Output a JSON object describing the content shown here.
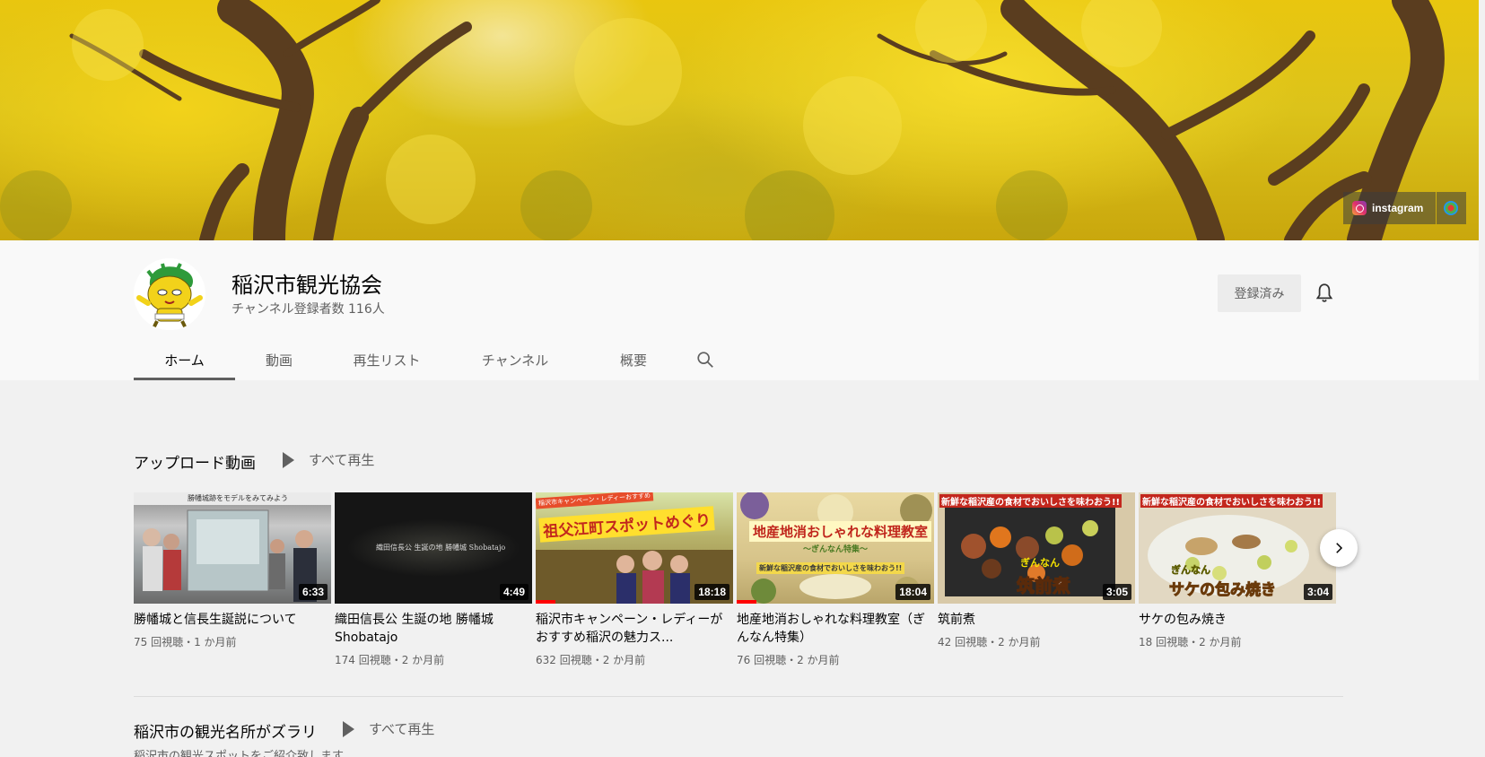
{
  "banner": {
    "links": [
      {
        "label": "instagram",
        "icon": "instagram-icon"
      },
      {
        "label": "",
        "icon": "external-link-icon"
      }
    ]
  },
  "channel": {
    "name": "稲沢市観光協会",
    "subscribers": "チャンネル登録者数 116人",
    "subscribed_label": "登録済み",
    "bell_icon": "bell-icon"
  },
  "tabs": [
    {
      "label": "ホーム",
      "active": true
    },
    {
      "label": "動画",
      "active": false
    },
    {
      "label": "再生リスト",
      "active": false
    },
    {
      "label": "チャンネル",
      "active": false
    },
    {
      "label": "概要",
      "active": false
    }
  ],
  "uploads": {
    "title": "アップロード動画",
    "play_all": "すべて再生",
    "videos": [
      {
        "title": "勝幡城と信長生誕説について",
        "meta": "75 回視聴・1 か月前",
        "duration": "6:33",
        "watched": 0
      },
      {
        "title": "織田信長公 生誕の地 勝幡城 Shobatajo",
        "meta": "174 回視聴・2 か月前",
        "duration": "4:49",
        "watched": 0
      },
      {
        "title": "稲沢市キャンペーン・レディーがおすすめ稲沢の魅力ス...",
        "meta": "632 回視聴・2 か月前",
        "duration": "18:18",
        "watched": 0.1
      },
      {
        "title": "地産地消おしゃれな料理教室（ぎんなん特集）",
        "meta": "76 回視聴・2 か月前",
        "duration": "18:04",
        "watched": 0.1
      },
      {
        "title": "筑前煮",
        "meta": "42 回視聴・2 か月前",
        "duration": "3:05",
        "watched": 0
      },
      {
        "title": "サケの包み焼き",
        "meta": "18 回視聴・2 か月前",
        "duration": "3:04",
        "watched": 0
      }
    ],
    "thumb_texts": [
      {
        "caption": "勝幡城跡をモデルをみてみよう"
      },
      {
        "caption": "織田信長公 生誕の地 勝幡城 Shobatajo"
      },
      {
        "caption": "祖父江町スポットめぐり",
        "tag": "稲沢市キャンペーン・レディーおすすめ"
      },
      {
        "caption": "地産地消おしゃれな料理教室",
        "sub": "〜ぎんなん特集〜",
        "band": "新鮮な稲沢産の食材でおいしさを味わおう!!"
      },
      {
        "caption": "筑前煮",
        "band": "新鮮な稲沢産の食材でおいしさを味わおう!!",
        "tag": "ぎんなん"
      },
      {
        "caption": "サケの包み焼き",
        "band": "新鮮な稲沢産の食材でおいしさを味わおう!!",
        "tag": "ぎんなん"
      }
    ]
  },
  "section2": {
    "title": "稲沢市の観光名所がズラリ",
    "play_all": "すべて再生",
    "description": "稲沢市の観光スポットをご紹介致します"
  },
  "colors": {
    "accent_red": "#ff0000",
    "banner_yellow": "#e9c60f",
    "page_bg": "#f1f1f1",
    "header_bg": "#f9f9f9"
  }
}
